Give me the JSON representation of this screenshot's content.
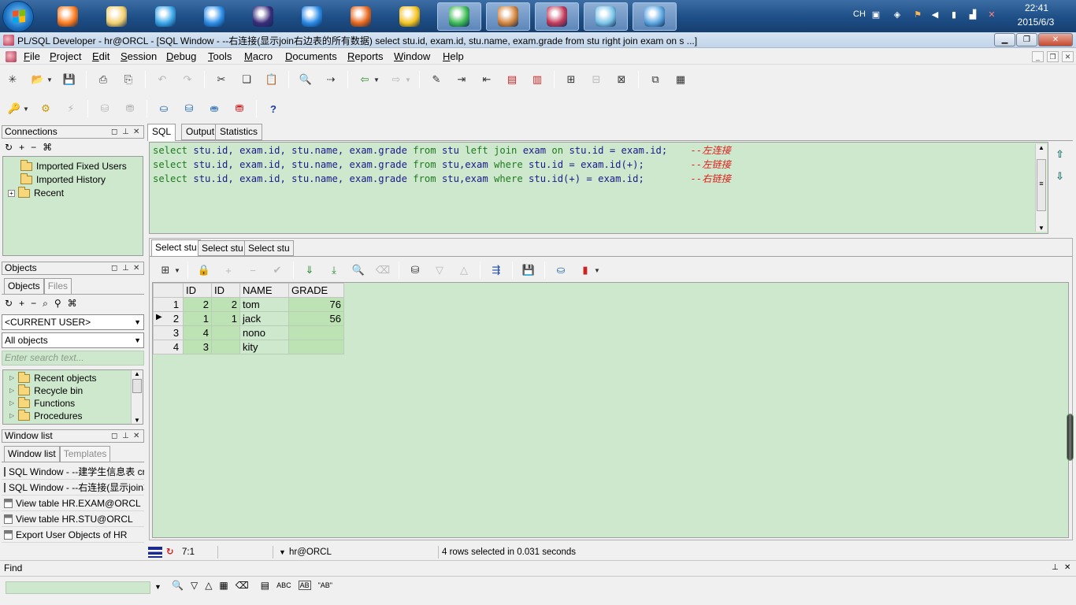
{
  "taskbar": {
    "apps": [
      {
        "icon": "media-player-icon",
        "color": "#ff7a1a"
      },
      {
        "icon": "file-explorer-icon",
        "color": "#f2cf6b"
      },
      {
        "icon": "cloud-sync-icon",
        "color": "#3aa6e8"
      },
      {
        "icon": "browser-q-icon",
        "color": "#2d8fe8"
      },
      {
        "icon": "eclipse-icon",
        "color": "#3b2b7a"
      },
      {
        "icon": "internet-explorer-icon",
        "color": "#2a8ae6"
      },
      {
        "icon": "firefox-icon",
        "color": "#e8661a"
      },
      {
        "icon": "music-player-icon",
        "color": "#f4c21d"
      },
      {
        "icon": "chrome-icon",
        "color": "#3cba54"
      },
      {
        "icon": "paint-icon",
        "color": "#d4843a"
      },
      {
        "icon": "plsql-developer-icon",
        "color": "#c43a5a"
      },
      {
        "icon": "notebook-icon",
        "color": "#7bc4e8"
      },
      {
        "icon": "image-viewer-icon",
        "color": "#5ba6e0"
      }
    ],
    "tray": {
      "ime": "CH",
      "time": "22:41",
      "date": "2015/6/3"
    }
  },
  "window": {
    "title": "PL/SQL Developer - hr@ORCL - [SQL Window - --右连接(显示join右边表的所有数据) select stu.id, exam.id, stu.name, exam.grade from stu right join exam on s ...]"
  },
  "menu": [
    "File",
    "Project",
    "Edit",
    "Session",
    "Debug",
    "Tools",
    "Macro",
    "Documents",
    "Reports",
    "Window",
    "Help"
  ],
  "connections": {
    "title": "Connections",
    "items": [
      {
        "label": "Imported Fixed Users"
      },
      {
        "label": "Imported History"
      },
      {
        "label": "Recent"
      }
    ]
  },
  "objects": {
    "title": "Objects",
    "tabs": [
      "Objects",
      "Files"
    ],
    "user_select": "<CURRENT USER>",
    "type_select": "All objects",
    "search_placeholder": "Enter search text...",
    "tree": [
      "Recent objects",
      "Recycle bin",
      "Functions",
      "Procedures"
    ]
  },
  "window_list": {
    "title": "Window list",
    "tabs": [
      "Window list",
      "Templates"
    ],
    "items": [
      "SQL Window - --建学生信息表 cr",
      "SQL Window - --右连接(显示join右",
      "View table HR.EXAM@ORCL",
      "View table HR.STU@ORCL",
      "Export User Objects of HR"
    ]
  },
  "editor": {
    "tabs": [
      "SQL",
      "Output",
      "Statistics"
    ],
    "lines": [
      {
        "code": "select stu.id, exam.id, stu.name, exam.grade from stu left join exam on stu.id = exam.id;",
        "comment": "--左连接"
      },
      {
        "code": "select stu.id, exam.id, stu.name, exam.grade from stu,exam where stu.id = exam.id(+);",
        "comment": "--左链接"
      },
      {
        "code": "select stu.id, exam.id, stu.name, exam.grade from stu,exam where stu.id(+) = exam.id;",
        "comment": "--右链接"
      }
    ]
  },
  "results": {
    "tabs": [
      "Select stu",
      "Select stu",
      "Select stu"
    ],
    "columns": [
      "ID",
      "ID",
      "NAME",
      "GRADE"
    ],
    "rows": [
      {
        "n": "1",
        "id1": "2",
        "id2": "2",
        "name": "tom",
        "grade": "76"
      },
      {
        "n": "2",
        "id1": "1",
        "id2": "1",
        "name": "jack",
        "grade": "56"
      },
      {
        "n": "3",
        "id1": "4",
        "id2": "",
        "name": "nono",
        "grade": ""
      },
      {
        "n": "4",
        "id1": "3",
        "id2": "",
        "name": "kity",
        "grade": ""
      }
    ],
    "current_row": 2
  },
  "status": {
    "position": "7:1",
    "connection": "hr@ORCL",
    "message": "4 rows selected in 0.031 seconds"
  },
  "find": {
    "title": "Find",
    "abc1": "ABC",
    "abc2": "AB",
    "abc3": "\"AB\""
  },
  "colors": {
    "editor_bg": "#cde8cd",
    "keyword": "#1f7a1f",
    "comment": "#e0201c"
  }
}
